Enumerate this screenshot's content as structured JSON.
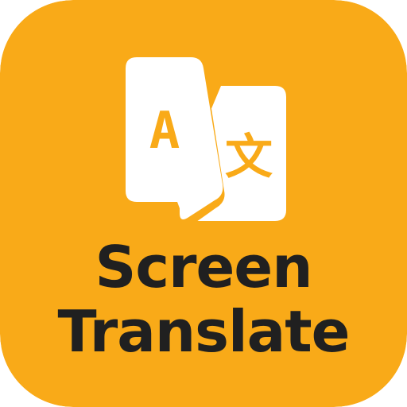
{
  "icon": {
    "title_line_1": "Screen",
    "title_line_2": "Translate",
    "glyph_left": "A",
    "glyph_right": "文"
  },
  "colors": {
    "background": "#f9aa18",
    "foreground": "#ffffff",
    "text": "#202020"
  },
  "icons": [
    "translate-icon"
  ]
}
